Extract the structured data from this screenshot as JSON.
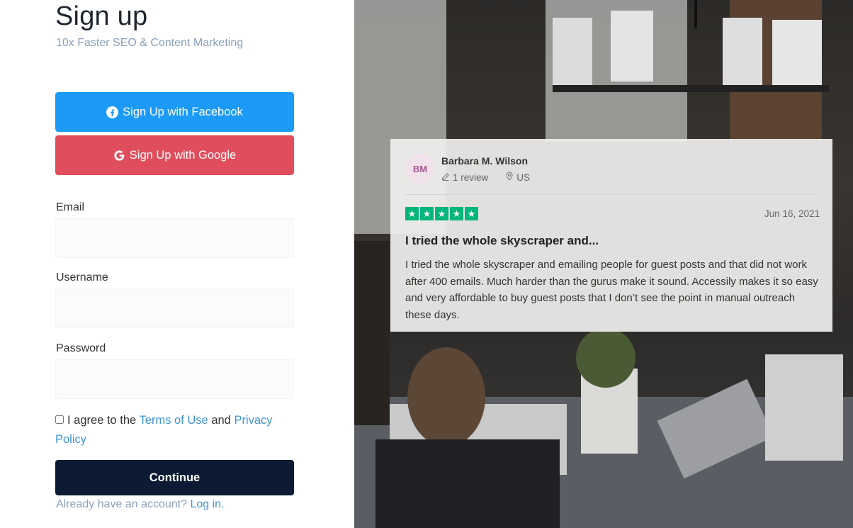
{
  "left": {
    "title": "Sign up",
    "subtitle": "10x Faster SEO & Content Marketing",
    "facebook_button": "Sign Up with Facebook",
    "google_button": "Sign Up with Google",
    "email_label": "Email",
    "email_value": "",
    "username_label": "Username",
    "username_value": "",
    "password_label": "Password",
    "password_value": "",
    "agree_prefix": "I agree to the",
    "terms_link": "Terms of Use",
    "agree_and": "and",
    "privacy_link": "Privacy Policy",
    "continue_button": "Continue",
    "already_text": "Already have an account?",
    "login_link": "Log in."
  },
  "review": {
    "avatar_initials": "BM",
    "name": "Barbara M. Wilson",
    "review_count": "1 review",
    "country": "US",
    "rating": 5,
    "date": "Jun 16, 2021",
    "title": "I tried the whole skyscraper and...",
    "body": "I tried the whole skyscraper and emailing people for guest posts and that did not work after 400 emails. Much harder than the gurus make it sound. Accessily makes it so easy and very affordable to buy guest posts that I don’t see the point in manual outreach these days."
  },
  "colors": {
    "facebook": "#1b9af7",
    "google": "#e04e5e",
    "continue": "#0c1a33",
    "link": "#3d95d6",
    "star": "#00b67a"
  },
  "icons": {
    "facebook": "facebook-icon",
    "google": "google-icon",
    "review": "pencil-icon",
    "location": "location-pin-icon",
    "star": "star-icon"
  }
}
